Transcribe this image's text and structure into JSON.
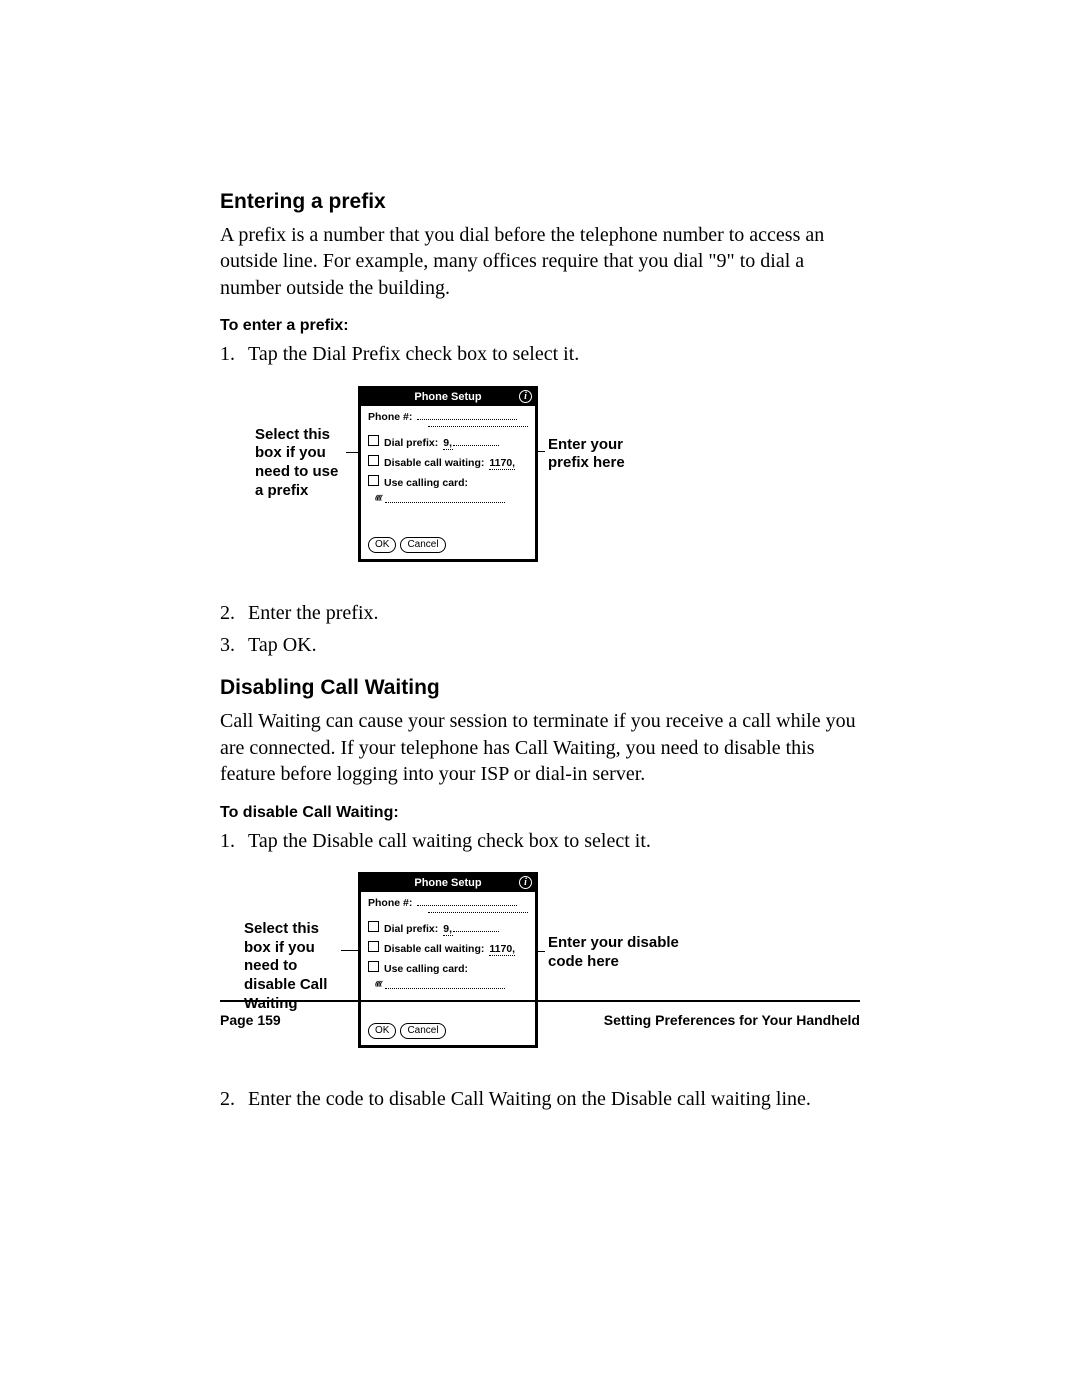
{
  "section1": {
    "title": "Entering a prefix",
    "intro": "A prefix is a number that you dial before the telephone number to access an outside line. For example, many offices require that you dial \"9\" to dial a number outside the building.",
    "subhead": "To enter a prefix:",
    "step1": "Tap the Dial Prefix check box to select it.",
    "step2": "Enter the prefix.",
    "step3": "Tap OK."
  },
  "figure1": {
    "callout_left": "Select this\nbox if you\nneed to use\na prefix",
    "callout_right": "Enter your\nprefix here"
  },
  "device": {
    "title": "Phone Setup",
    "info": "i",
    "phone_label": "Phone #:",
    "dial_prefix_label": "Dial prefix:",
    "dial_prefix_value": "9,",
    "disable_cw_label": "Disable call waiting:",
    "disable_cw_value": "1170,",
    "use_card_label": "Use calling card:",
    "ok": "OK",
    "cancel": "Cancel"
  },
  "section2": {
    "title": "Disabling Call Waiting",
    "intro": "Call Waiting can cause your session to terminate if you receive a call while you are connected. If your telephone has Call Waiting, you need to disable this feature before logging into your ISP or dial-in server.",
    "subhead": "To disable Call Waiting:",
    "step1": "Tap the Disable call waiting check box to select it.",
    "step2": "Enter the code to disable Call Waiting on the Disable call waiting line."
  },
  "figure2": {
    "callout_left": "Select this\nbox if you\nneed to\ndisable Call\nWaiting",
    "callout_right": "Enter your disable\ncode here"
  },
  "footer": {
    "page": "Page 159",
    "title": "Setting Preferences for Your Handheld"
  }
}
